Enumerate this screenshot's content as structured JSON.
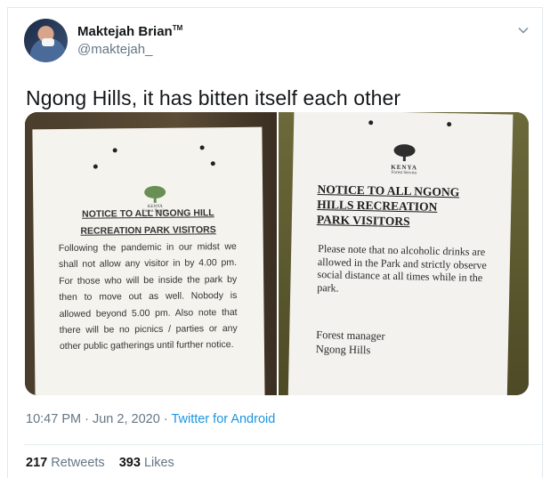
{
  "tweet": {
    "display_name": "Maktejah Brian",
    "display_name_badge": "TM",
    "handle": "@maktejah_",
    "text": "Ngong Hills, it has bitten itself each other",
    "time": "10:47 PM",
    "date": "Jun 2, 2020",
    "sep": "·",
    "source": "Twitter for Android",
    "retweets_count": "217",
    "retweets_label": "Retweets",
    "likes_count": "393",
    "likes_label": "Likes"
  },
  "media": {
    "left_notice": {
      "logo_lines": [
        "KENYA",
        "Forest Service"
      ],
      "title_lines": [
        "NOTICE TO ALL NGONG HILL",
        "RECREATION PARK VISITORS"
      ],
      "body": "Following the pandemic in our midst we shall not allow any visitor in by 4.00 pm. For those who will be inside the park by then to move out as well. Nobody is allowed beyond 5.00 pm. Also note that there will be no picnics / parties or any other public gatherings until further notice."
    },
    "right_notice": {
      "logo_lines": [
        "KENYA",
        "Forest Service"
      ],
      "title_lines": [
        "NOTICE TO ALL NGONG",
        "HILLS RECREATION",
        "PARK VISITORS"
      ],
      "body": "Please note that no alcoholic drinks are allowed in the Park and strictly observe social distance at all times while in the park.",
      "sign_lines": [
        "Forest manager",
        "Ngong Hills"
      ]
    }
  },
  "icons": {
    "avatar": "avatar-image",
    "menu": "chevron-down-icon"
  },
  "colors": {
    "link": "#1b95e0",
    "muted": "#657786",
    "text": "#14171a"
  }
}
